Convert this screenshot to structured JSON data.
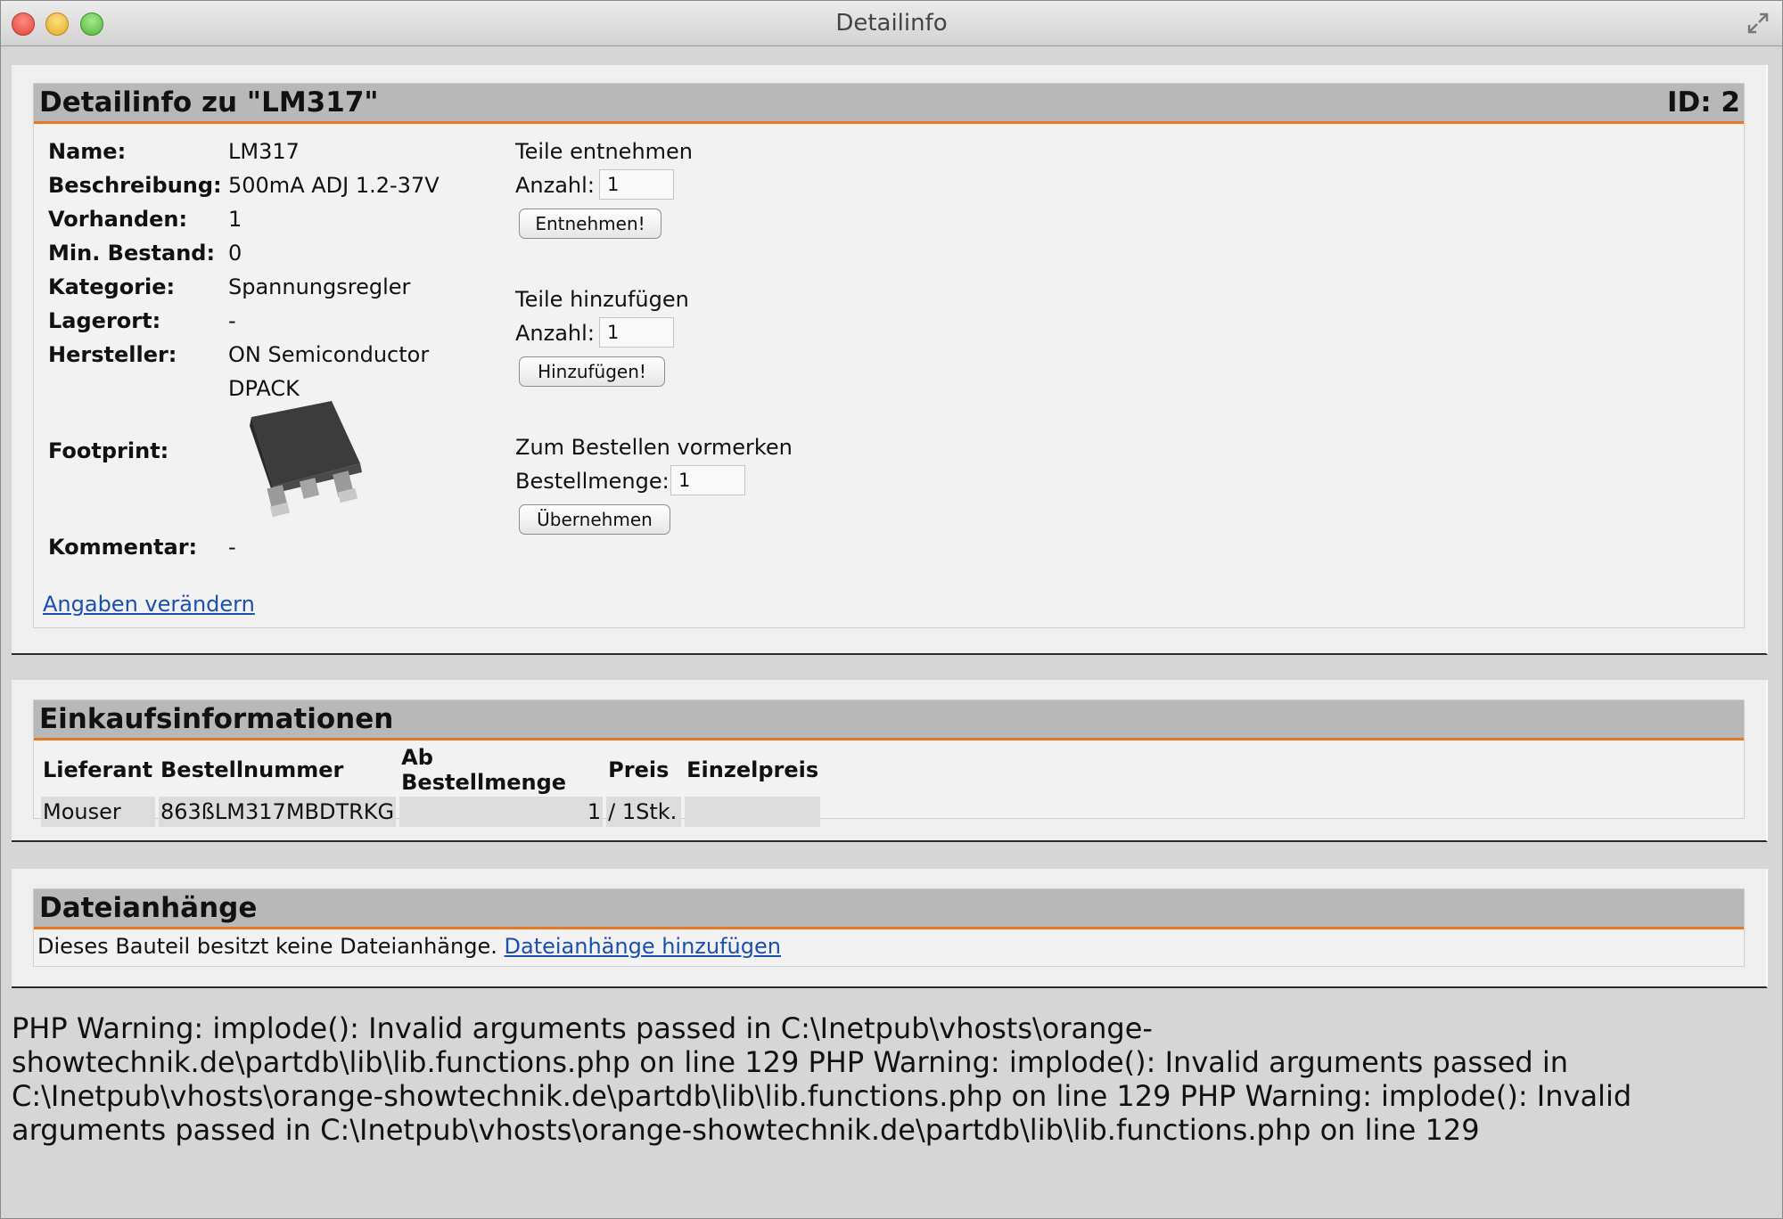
{
  "window": {
    "title": "Detailinfo"
  },
  "detail": {
    "heading": "Detailinfo zu \"LM317\"",
    "id": "ID: 2",
    "labels": {
      "name": "Name:",
      "beschreibung": "Beschreibung:",
      "vorhanden": "Vorhanden:",
      "min_bestand": "Min. Bestand:",
      "kategorie": "Kategorie:",
      "lagerort": "Lagerort:",
      "hersteller": "Hersteller:",
      "footprint": "Footprint:",
      "kommentar": "Kommentar:"
    },
    "values": {
      "name": "LM317",
      "beschreibung": "500mA ADJ 1.2-37V",
      "vorhanden": "1",
      "min_bestand": "0",
      "kategorie": "Spannungsregler",
      "lagerort": "-",
      "hersteller": "ON Semiconductor",
      "footprint": "DPACK",
      "kommentar": "-"
    },
    "edit_link": "Angaben verändern",
    "entnehmen": {
      "title": "Teile entnehmen",
      "label": "Anzahl:",
      "value": "1",
      "button": "Entnehmen!"
    },
    "hinzufuegen": {
      "title": "Teile hinzufügen",
      "label": "Anzahl:",
      "value": "1",
      "button": "Hinzufügen!"
    },
    "bestellen": {
      "title": "Zum Bestellen vormerken",
      "label": "Bestellmenge:",
      "value": "1",
      "button": "Übernehmen"
    }
  },
  "einkauf": {
    "heading": "Einkaufsinformationen",
    "columns": [
      "Lieferant",
      "Bestellnummer",
      "Ab Bestellmenge",
      "Preis",
      "Einzelpreis"
    ],
    "rows": [
      {
        "lieferant": "Mouser",
        "bestellnummer": "863ßLM317MBDTRKG",
        "ab_bestellmenge": "1",
        "preis": "/ 1Stk.",
        "einzelpreis": ""
      }
    ]
  },
  "dateien": {
    "heading": "Dateianhänge",
    "text": "Dieses Bauteil besitzt keine Dateianhänge.",
    "link": "Dateianhänge hinzufügen"
  },
  "warning": "PHP Warning: implode(): Invalid arguments passed in C:\\Inetpub\\vhosts\\orange-showtechnik.de\\partdb\\lib\\lib.functions.php on line 129 PHP Warning: implode(): Invalid arguments passed in C:\\Inetpub\\vhosts\\orange-showtechnik.de\\partdb\\lib\\lib.functions.php on line 129 PHP Warning: implode(): Invalid arguments passed in C:\\Inetpub\\vhosts\\orange-showtechnik.de\\partdb\\lib\\lib.functions.php on line 129"
}
